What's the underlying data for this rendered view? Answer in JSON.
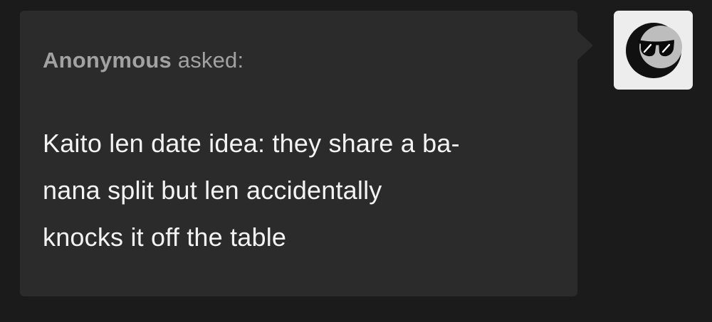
{
  "ask": {
    "asker_name": "Anonymous",
    "asked_label": "asked:",
    "question_lines": [
      "Kaito len date idea: they share a ba-",
      "nana split but len accidentally",
      "knocks it off the table"
    ]
  },
  "avatar": {
    "icon": "anonymous-sunglasses-avatar-icon"
  },
  "colors": {
    "page_background": "#1c1b1b",
    "bubble_background": "#2b2b2b",
    "asker_text": "#a2a2a2",
    "question_text": "#f3f3f3",
    "avatar_background": "#eeeded"
  }
}
